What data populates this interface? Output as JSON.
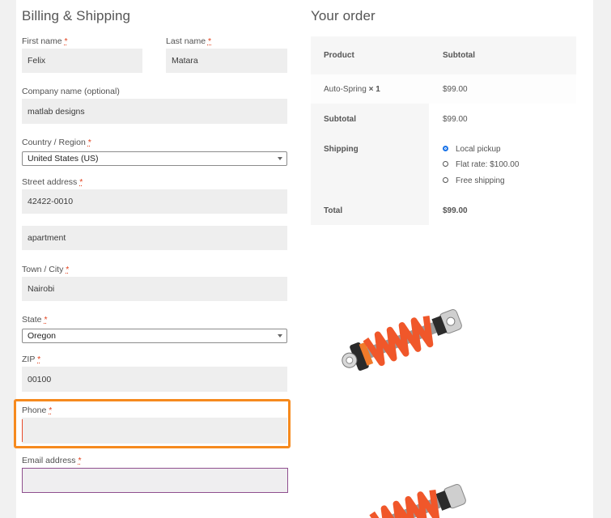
{
  "billing": {
    "title": "Billing & Shipping",
    "required_mark": "*",
    "first_name": {
      "label": "First name",
      "value": "Felix"
    },
    "last_name": {
      "label": "Last name",
      "value": "Matara"
    },
    "company": {
      "label": "Company name (optional)",
      "value": "matlab designs"
    },
    "country": {
      "label": "Country / Region",
      "value": "United States (US)"
    },
    "street": {
      "label": "Street address",
      "value": "42422-0010",
      "value2": "apartment"
    },
    "town": {
      "label": "Town / City",
      "value": "Nairobi"
    },
    "state": {
      "label": "State",
      "value": "Oregon"
    },
    "zip": {
      "label": "ZIP",
      "value": "00100"
    },
    "phone": {
      "label": "Phone",
      "value": ""
    },
    "email": {
      "label": "Email address",
      "value": ""
    }
  },
  "order": {
    "title": "Your order",
    "col_product": "Product",
    "col_subtotal": "Subtotal",
    "item_name": "Auto-Spring",
    "item_qty": "× 1",
    "item_price": "$99.00",
    "subtotal_label": "Subtotal",
    "subtotal_value": "$99.00",
    "shipping_label": "Shipping",
    "shipping_options": [
      "Local pickup",
      "Flat rate: $100.00",
      "Free shipping"
    ],
    "shipping_selected": 0,
    "total_label": "Total",
    "total_value": "$99.00"
  },
  "colors": {
    "highlight": "#f68a1e",
    "required": "#e2401c",
    "spring": "#f0572a",
    "radio_checked": "#1a73e8"
  }
}
